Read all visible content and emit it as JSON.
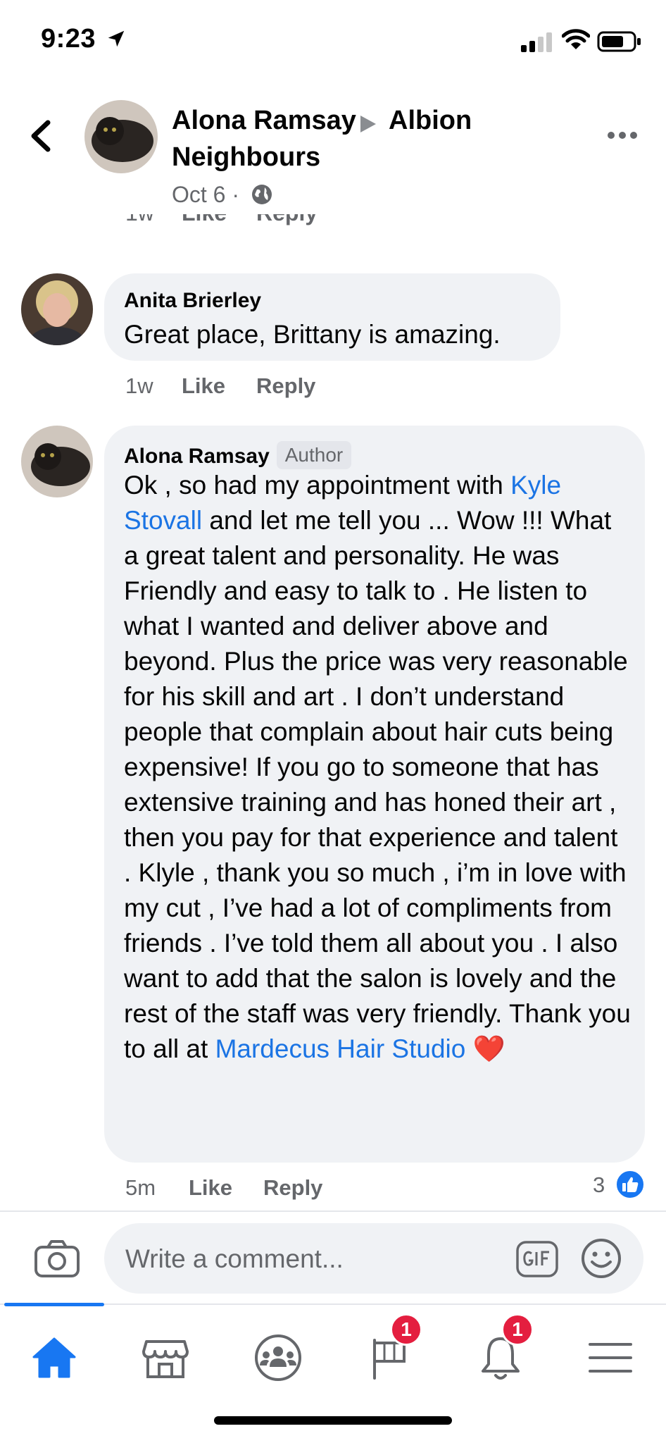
{
  "status_bar": {
    "time": "9:23"
  },
  "post": {
    "author": "Alona Ramsay",
    "group_line1": "Albion",
    "group_line2": "Neighbours",
    "date": "Oct 6 ·"
  },
  "cut_comment": {
    "time": "1w",
    "like": "Like",
    "reply": "Reply"
  },
  "comments": [
    {
      "name": "Anita Brierley",
      "text": "Great place, Brittany is amazing.",
      "time": "1w",
      "like": "Like",
      "reply": "Reply"
    },
    {
      "name": "Alona Ramsay",
      "badge": "Author",
      "text_start": "Ok , so had my appointment with ",
      "mention": "Kyle Stovall",
      "text_mid": "  and let me tell you ... Wow !!! What a great talent and personality. He was Friendly and easy to talk to . He listen to what I wanted and deliver above and beyond. Plus the price was very reasonable for his skill and art . I don’t understand people that complain about hair cuts being expensive! If you go to someone that has extensive training and has honed their art , then you pay for that experience and talent . Klyle , thank you so much , i’m in love with my cut , I’ve had a lot of compliments from friends . I’ve told them all about you . I also want to add that the salon is lovely and the rest of the staff was very friendly. Thank you to all at ",
      "page_link": "Mardecus Hair Studio",
      "heart": "❤️",
      "time": "5m",
      "like": "Like",
      "reply": "Reply",
      "reaction_count": "3"
    }
  ],
  "composer": {
    "placeholder": "Write a comment..."
  },
  "nav": {
    "items": [
      {
        "icon": "home-icon",
        "active": true
      },
      {
        "icon": "marketplace-icon"
      },
      {
        "icon": "groups-icon"
      },
      {
        "icon": "pages-flag-icon",
        "badge": "1"
      },
      {
        "icon": "notifications-bell-icon",
        "badge": "1"
      },
      {
        "icon": "menu-icon"
      }
    ]
  },
  "colors": {
    "accent": "#1877f2",
    "link": "#1b74e4",
    "badge": "#e41e3f",
    "bubble": "#f0f2f5"
  }
}
